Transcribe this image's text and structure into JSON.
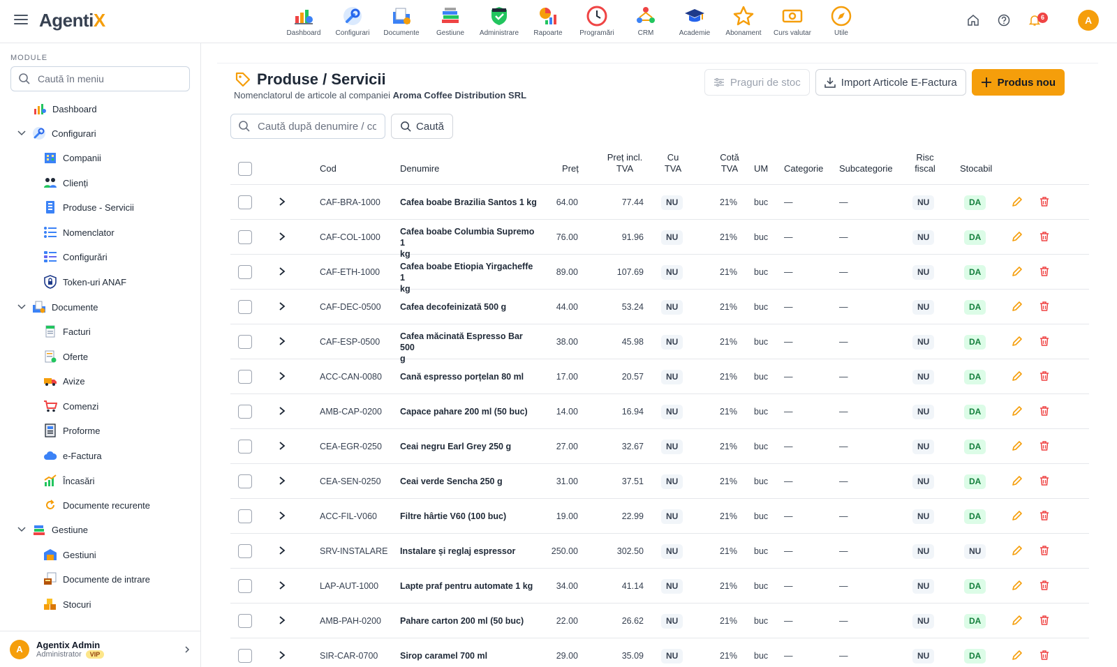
{
  "app": {
    "logo_main": "Agenti",
    "logo_accent": "X",
    "notif_count": "6",
    "avatar_letter": "A"
  },
  "modules": [
    {
      "label": "Dashboard",
      "icon": "dashboard-icon"
    },
    {
      "label": "Configurari",
      "icon": "wrench-icon"
    },
    {
      "label": "Documente",
      "icon": "documents-icon"
    },
    {
      "label": "Gestiune",
      "icon": "books-icon"
    },
    {
      "label": "Administrare",
      "icon": "shield-icon"
    },
    {
      "label": "Rapoarte",
      "icon": "reports-icon"
    },
    {
      "label": "Programări",
      "icon": "clock-icon"
    },
    {
      "label": "CRM",
      "icon": "crm-icon"
    },
    {
      "label": "Academie",
      "icon": "graduation-cap-icon"
    },
    {
      "label": "Abonament",
      "icon": "star-icon"
    },
    {
      "label": "Curs valutar",
      "icon": "banknote-icon"
    },
    {
      "label": "Utile",
      "icon": "compass-icon"
    }
  ],
  "sidebar": {
    "title": "MODULE",
    "search_placeholder": "Caută în meniu",
    "items": [
      {
        "label": "Dashboard",
        "icon": "dashboard-icon"
      },
      {
        "label": "Configurari",
        "icon": "wrench-icon"
      },
      {
        "label": "Companii",
        "icon": "building-icon"
      },
      {
        "label": "Clienți",
        "icon": "people-icon"
      },
      {
        "label": "Produse - Servicii",
        "icon": "product-list-icon"
      },
      {
        "label": "Nomenclator",
        "icon": "list-icon"
      },
      {
        "label": "Configurări",
        "icon": "settings-list-icon"
      },
      {
        "label": "Token-uri ANAF",
        "icon": "lock-shield-icon"
      },
      {
        "label": "Documente",
        "icon": "documents-icon"
      },
      {
        "label": "Facturi",
        "icon": "invoice-icon"
      },
      {
        "label": "Oferte",
        "icon": "offer-icon"
      },
      {
        "label": "Avize",
        "icon": "truck-icon"
      },
      {
        "label": "Comenzi",
        "icon": "cart-icon"
      },
      {
        "label": "Proforme",
        "icon": "proforma-icon"
      },
      {
        "label": "e-Factura",
        "icon": "cloud-icon"
      },
      {
        "label": "Încasări",
        "icon": "chart-up-icon"
      },
      {
        "label": "Documente recurente",
        "icon": "recurring-icon"
      },
      {
        "label": "Gestiune",
        "icon": "books-icon"
      },
      {
        "label": "Gestiuni",
        "icon": "warehouse-icon"
      },
      {
        "label": "Documente de intrare",
        "icon": "incoming-docs-icon"
      },
      {
        "label": "Stocuri",
        "icon": "boxes-icon"
      }
    ],
    "user": {
      "name": "Agentix Admin",
      "role": "Administrator",
      "badge": "VIP",
      "avatar": "A"
    }
  },
  "page": {
    "title": "Produse / Servicii",
    "subtitle_prefix": "Nomenclatorul de articole al companiei",
    "company": "Aroma Coffee Distribution SRL",
    "btn_thresholds": "Praguri de stoc",
    "btn_import": "Import Articole E-Factura",
    "btn_new": "Produs nou",
    "search_placeholder": "Caută după denumire / cod",
    "search_btn": "Caută"
  },
  "table": {
    "headers": {
      "cod": "Cod",
      "denumire": "Denumire",
      "pret": "Preț",
      "pret_tva_1": "Preț incl.",
      "pret_tva_2": "TVA",
      "cu_tva_1": "Cu",
      "cu_tva_2": "TVA",
      "cota_1": "Cotă",
      "cota_2": "TVA",
      "um": "UM",
      "categorie": "Categorie",
      "subcategorie": "Subcategorie",
      "risc_1": "Risc",
      "risc_2": "fiscal",
      "stocabil": "Stocabil"
    },
    "rows": [
      {
        "cod": "CAF-BRA-1000",
        "den1": "Cafea boabe Brazilia Santos 1 kg",
        "den2": "",
        "pret": "64.00",
        "pret_tva": "77.44",
        "cu_tva": "NU",
        "cota": "21%",
        "um": "buc",
        "cat": "—",
        "subcat": "—",
        "risc": "NU",
        "stocabil": "DA"
      },
      {
        "cod": "CAF-COL-1000",
        "den1": "Cafea boabe Columbia Supremo 1",
        "den2": "kg",
        "pret": "76.00",
        "pret_tva": "91.96",
        "cu_tva": "NU",
        "cota": "21%",
        "um": "buc",
        "cat": "—",
        "subcat": "—",
        "risc": "NU",
        "stocabil": "DA"
      },
      {
        "cod": "CAF-ETH-1000",
        "den1": "Cafea boabe Etiopia Yirgacheffe 1",
        "den2": "kg",
        "pret": "89.00",
        "pret_tva": "107.69",
        "cu_tva": "NU",
        "cota": "21%",
        "um": "buc",
        "cat": "—",
        "subcat": "—",
        "risc": "NU",
        "stocabil": "DA"
      },
      {
        "cod": "CAF-DEC-0500",
        "den1": "Cafea decofeinizată 500 g",
        "den2": "",
        "pret": "44.00",
        "pret_tva": "53.24",
        "cu_tva": "NU",
        "cota": "21%",
        "um": "buc",
        "cat": "—",
        "subcat": "—",
        "risc": "NU",
        "stocabil": "DA"
      },
      {
        "cod": "CAF-ESP-0500",
        "den1": "Cafea măcinată Espresso Bar 500",
        "den2": "g",
        "pret": "38.00",
        "pret_tva": "45.98",
        "cu_tva": "NU",
        "cota": "21%",
        "um": "buc",
        "cat": "—",
        "subcat": "—",
        "risc": "NU",
        "stocabil": "DA"
      },
      {
        "cod": "ACC-CAN-0080",
        "den1": "Cană espresso porțelan 80 ml",
        "den2": "",
        "pret": "17.00",
        "pret_tva": "20.57",
        "cu_tva": "NU",
        "cota": "21%",
        "um": "buc",
        "cat": "—",
        "subcat": "—",
        "risc": "NU",
        "stocabil": "DA"
      },
      {
        "cod": "AMB-CAP-0200",
        "den1": "Capace pahare 200 ml (50 buc)",
        "den2": "",
        "pret": "14.00",
        "pret_tva": "16.94",
        "cu_tva": "NU",
        "cota": "21%",
        "um": "buc",
        "cat": "—",
        "subcat": "—",
        "risc": "NU",
        "stocabil": "DA"
      },
      {
        "cod": "CEA-EGR-0250",
        "den1": "Ceai negru Earl Grey 250 g",
        "den2": "",
        "pret": "27.00",
        "pret_tva": "32.67",
        "cu_tva": "NU",
        "cota": "21%",
        "um": "buc",
        "cat": "—",
        "subcat": "—",
        "risc": "NU",
        "stocabil": "DA"
      },
      {
        "cod": "CEA-SEN-0250",
        "den1": "Ceai verde Sencha 250 g",
        "den2": "",
        "pret": "31.00",
        "pret_tva": "37.51",
        "cu_tva": "NU",
        "cota": "21%",
        "um": "buc",
        "cat": "—",
        "subcat": "—",
        "risc": "NU",
        "stocabil": "DA"
      },
      {
        "cod": "ACC-FIL-V060",
        "den1": "Filtre hârtie V60 (100 buc)",
        "den2": "",
        "pret": "19.00",
        "pret_tva": "22.99",
        "cu_tva": "NU",
        "cota": "21%",
        "um": "buc",
        "cat": "—",
        "subcat": "—",
        "risc": "NU",
        "stocabil": "DA"
      },
      {
        "cod": "SRV-INSTALARE",
        "den1": "Instalare și reglaj espressor",
        "den2": "",
        "pret": "250.00",
        "pret_tva": "302.50",
        "cu_tva": "NU",
        "cota": "21%",
        "um": "buc",
        "cat": "—",
        "subcat": "—",
        "risc": "NU",
        "stocabil": "NU"
      },
      {
        "cod": "LAP-AUT-1000",
        "den1": "Lapte praf pentru automate 1 kg",
        "den2": "",
        "pret": "34.00",
        "pret_tva": "41.14",
        "cu_tva": "NU",
        "cota": "21%",
        "um": "buc",
        "cat": "—",
        "subcat": "—",
        "risc": "NU",
        "stocabil": "DA"
      },
      {
        "cod": "AMB-PAH-0200",
        "den1": "Pahare carton 200 ml (50 buc)",
        "den2": "",
        "pret": "22.00",
        "pret_tva": "26.62",
        "cu_tva": "NU",
        "cota": "21%",
        "um": "buc",
        "cat": "—",
        "subcat": "—",
        "risc": "NU",
        "stocabil": "DA"
      },
      {
        "cod": "SIR-CAR-0700",
        "den1": "Sirop caramel 700 ml",
        "den2": "",
        "pret": "29.00",
        "pret_tva": "35.09",
        "cu_tva": "NU",
        "cota": "21%",
        "um": "buc",
        "cat": "—",
        "subcat": "—",
        "risc": "NU",
        "stocabil": "DA"
      }
    ]
  },
  "colors": {
    "accent": "#f59e0b",
    "success_bg": "#dcfce7",
    "success_text": "#15803d",
    "danger": "#ef4444"
  }
}
